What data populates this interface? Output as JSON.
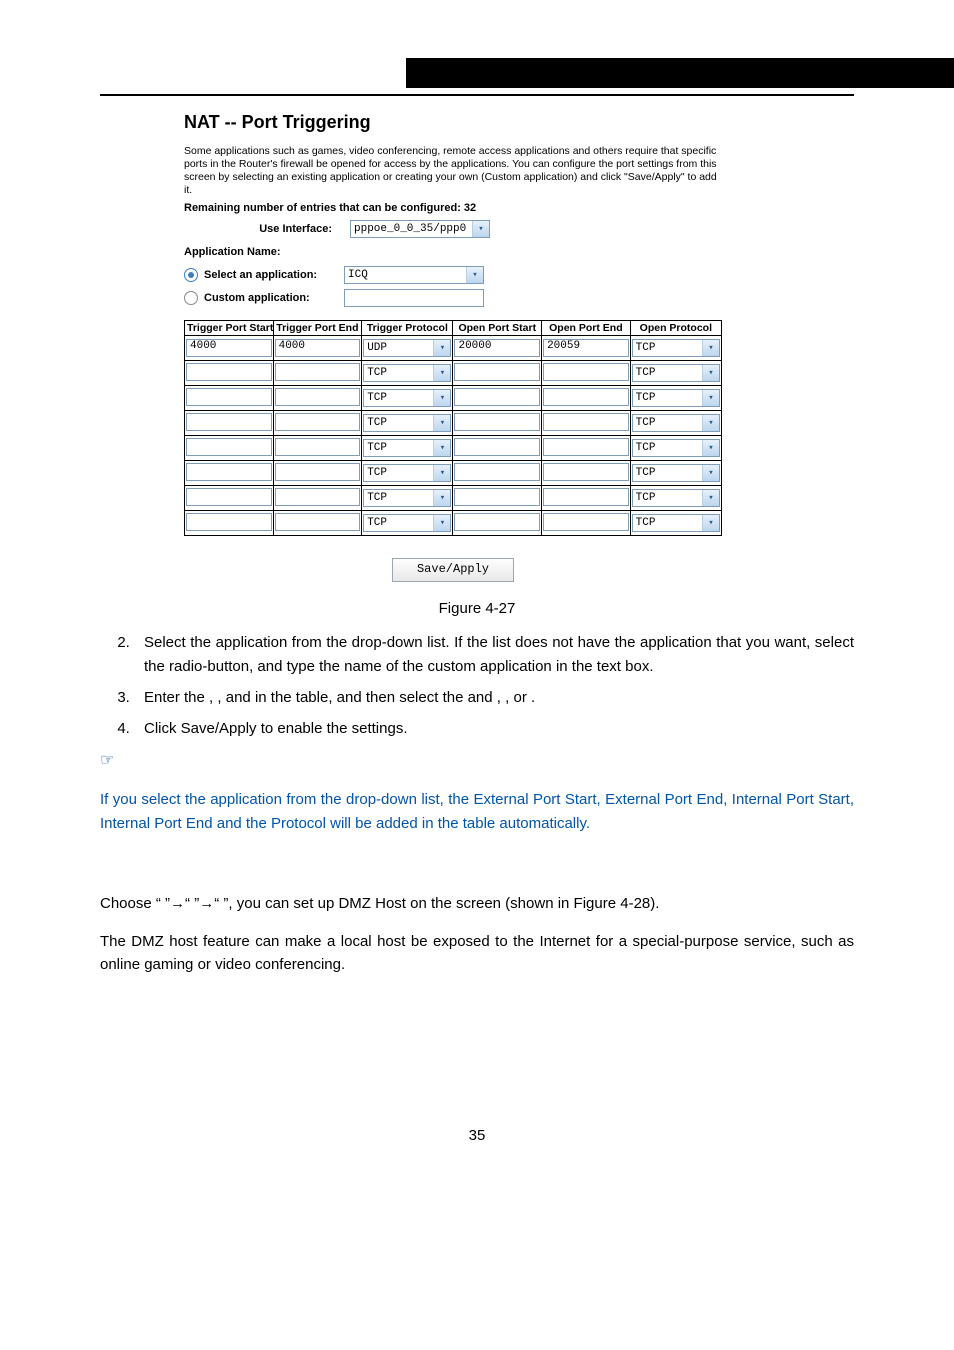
{
  "shot": {
    "title": "NAT -- Port Triggering",
    "intro": "Some applications such as games, video conferencing, remote access applications and others require that specific ports in the Router's firewall be opened for access by the applications. You can configure the port settings from this screen by selecting an existing application or creating your own (Custom application) and click \"Save/Apply\" to add it.",
    "remaining": "Remaining number of entries that can be configured: 32",
    "use_interface_label": "Use Interface:",
    "use_interface_value": "pppoe_0_0_35/ppp0",
    "app_name_label": "Application Name:",
    "radio_select_label": "Select an application:",
    "radio_select_value": "ICQ",
    "radio_custom_label": "Custom application:",
    "radio_custom_value": "",
    "headers": {
      "h1": "Trigger Port Start",
      "h2": "Trigger Port End",
      "h3": "Trigger Protocol",
      "h4": "Open Port Start",
      "h5": "Open Port End",
      "h6": "Open Protocol"
    },
    "rows": [
      {
        "tps": "4000",
        "tpe": "4000",
        "tp": "UDP",
        "ops": "20000",
        "ope": "20059",
        "op": "TCP"
      },
      {
        "tps": "",
        "tpe": "",
        "tp": "TCP",
        "ops": "",
        "ope": "",
        "op": "TCP"
      },
      {
        "tps": "",
        "tpe": "",
        "tp": "TCP",
        "ops": "",
        "ope": "",
        "op": "TCP"
      },
      {
        "tps": "",
        "tpe": "",
        "tp": "TCP",
        "ops": "",
        "ope": "",
        "op": "TCP"
      },
      {
        "tps": "",
        "tpe": "",
        "tp": "TCP",
        "ops": "",
        "ope": "",
        "op": "TCP"
      },
      {
        "tps": "",
        "tpe": "",
        "tp": "TCP",
        "ops": "",
        "ope": "",
        "op": "TCP"
      },
      {
        "tps": "",
        "tpe": "",
        "tp": "TCP",
        "ops": "",
        "ope": "",
        "op": "TCP"
      },
      {
        "tps": "",
        "tpe": "",
        "tp": "TCP",
        "ops": "",
        "ope": "",
        "op": "TCP"
      }
    ],
    "save_label": "Save/Apply"
  },
  "figcap": "Figure 4-27",
  "steps": {
    "s2a": "Select the application from the drop-down list. If the list does not have the application that you want, select the ",
    "s2b": " radio-button, and type the name of the custom application in the text box.",
    "s3a": "Enter the ",
    "s3_comma": ", ",
    "s3_and": " and ",
    "s3b": " in the table, and then select the ",
    "s3c": " and ",
    "s3_or": " or ",
    "s3_period": ".",
    "s4": "Click Save/Apply to enable the settings."
  },
  "note_icon": "☞",
  "note_text": "If you select the application from the drop-down list, the External Port Start, External Port End, Internal Port Start, Internal Port End and the Protocol will be added in the table automatically.",
  "dmz": {
    "p1a": "Choose “",
    "arrow": "”→“",
    "p1b": "”, you can set up DMZ Host on the screen (shown in Figure 4-28).",
    "p2": "The DMZ host feature can make a local host be exposed to the Internet for a special-purpose service, such as online gaming or video conferencing."
  },
  "page_number": "35"
}
